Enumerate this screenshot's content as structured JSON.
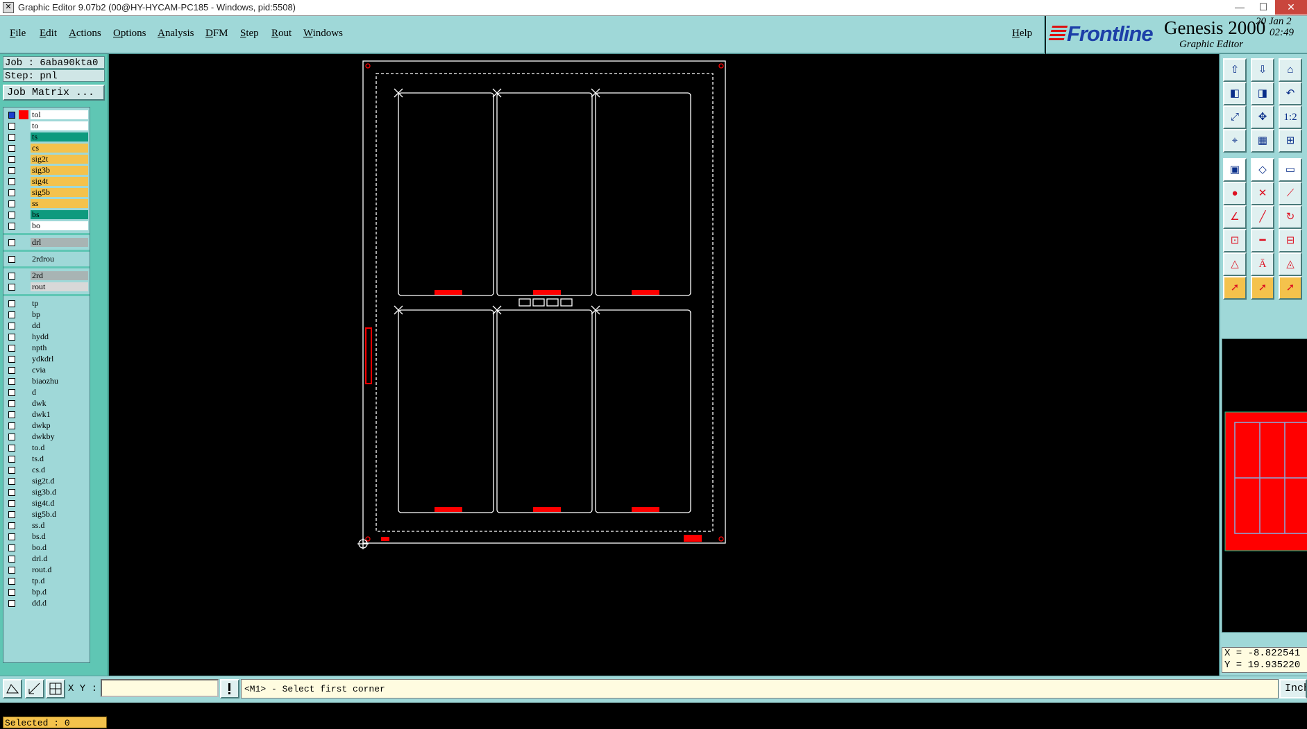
{
  "titlebar": {
    "title": "Graphic Editor 9.07b2 (00@HY-HYCAM-PC185 - Windows, pid:5508)"
  },
  "menu": [
    "File",
    "Edit",
    "Actions",
    "Options",
    "Analysis",
    "DFM",
    "Step",
    "Rout",
    "Windows"
  ],
  "help": "Help",
  "brand": {
    "logo": "Frontline",
    "product": "Genesis 2000",
    "subtitle": "Graphic Editor",
    "date": "20 Jan 2",
    "time": "02:49"
  },
  "job": {
    "job_line": "Job : 6aba90kta0",
    "step_line": "Step: pnl",
    "matrix_button": "Job Matrix ..."
  },
  "layer_groups": [
    [
      {
        "name": "tol",
        "color": "#ffffff"
      },
      {
        "name": "to",
        "color": "#ffffff"
      },
      {
        "name": "ts",
        "color": "#0e9a7e"
      },
      {
        "name": "cs",
        "color": "#f4c24c"
      },
      {
        "name": "sig2t",
        "color": "#f4c24c"
      },
      {
        "name": "sig3b",
        "color": "#f4c24c"
      },
      {
        "name": "sig4t",
        "color": "#f4c24c"
      },
      {
        "name": "sig5b",
        "color": "#f4c24c"
      },
      {
        "name": "ss",
        "color": "#f4c24c"
      },
      {
        "name": "bs",
        "color": "#0e9a7e"
      },
      {
        "name": "bo",
        "color": "#ffffff"
      }
    ],
    [
      {
        "name": "drl",
        "color": "#a8b4b4"
      }
    ],
    [
      {
        "name": "2rdrou",
        "color": "#9fd8d8"
      }
    ],
    [
      {
        "name": "2rd",
        "color": "#a8b4b4"
      },
      {
        "name": "rout",
        "color": "#d8d8d8"
      }
    ],
    [
      {
        "name": "tp",
        "color": "#9fd8d8"
      },
      {
        "name": "bp",
        "color": "#9fd8d8"
      },
      {
        "name": "dd",
        "color": "#9fd8d8"
      },
      {
        "name": "hydd",
        "color": "#9fd8d8"
      },
      {
        "name": "npth",
        "color": "#9fd8d8"
      },
      {
        "name": "ydkdrl",
        "color": "#9fd8d8"
      },
      {
        "name": "cvia",
        "color": "#9fd8d8"
      },
      {
        "name": "biaozhu",
        "color": "#9fd8d8"
      },
      {
        "name": "d",
        "color": "#9fd8d8"
      },
      {
        "name": "dwk",
        "color": "#9fd8d8"
      },
      {
        "name": "dwk1",
        "color": "#9fd8d8"
      },
      {
        "name": "dwkp",
        "color": "#9fd8d8"
      },
      {
        "name": "dwkby",
        "color": "#9fd8d8"
      },
      {
        "name": "to.d",
        "color": "#9fd8d8"
      },
      {
        "name": "ts.d",
        "color": "#9fd8d8"
      },
      {
        "name": "cs.d",
        "color": "#9fd8d8"
      },
      {
        "name": "sig2t.d",
        "color": "#9fd8d8"
      },
      {
        "name": "sig3b.d",
        "color": "#9fd8d8"
      },
      {
        "name": "sig4t.d",
        "color": "#9fd8d8"
      },
      {
        "name": "sig5b.d",
        "color": "#9fd8d8"
      },
      {
        "name": "ss.d",
        "color": "#9fd8d8"
      },
      {
        "name": "bs.d",
        "color": "#9fd8d8"
      },
      {
        "name": "bo.d",
        "color": "#9fd8d8"
      },
      {
        "name": "drl.d",
        "color": "#9fd8d8"
      },
      {
        "name": "rout.d",
        "color": "#9fd8d8"
      },
      {
        "name": "tp.d",
        "color": "#9fd8d8"
      },
      {
        "name": "bp.d",
        "color": "#9fd8d8"
      },
      {
        "name": "dd.d",
        "color": "#9fd8d8"
      }
    ]
  ],
  "selected_text": "Selected : 0",
  "coords": {
    "x": "X = -8.822541",
    "y": "Y = 19.935220"
  },
  "bottom": {
    "xy_label": "X Y :",
    "xy_value": "",
    "message": "<M1> - Select first corner",
    "units": "Inch"
  },
  "colors": {
    "panel": "#9fd8d8",
    "left_panel": "#5fc6b4",
    "highlight": "#f4c24c",
    "feature_red": "#ff0000",
    "outline": "#ffffff"
  },
  "toolbox_icons": [
    "move-to-top-icon",
    "move-to-bottom-icon",
    "home-view-icon",
    "pan-left-icon",
    "pan-right-icon",
    "undo-view-icon",
    "zoom-fit-icon",
    "zoom-center-icon",
    "zoom-ratio-icon",
    "snap-icon",
    "grid-icon",
    "layers-display-icon",
    "fill-mode-icon",
    "outline-mode-icon",
    "ruler-icon",
    "pad-icon",
    "cross-icon",
    "connect-icon",
    "line-icon",
    "slash-icon",
    "arc-icon",
    "select-area-icon",
    "horizontal-line-icon",
    "measure-icon",
    "triangle-icon",
    "polygon-icon",
    "surface-icon",
    "pointer-icon",
    "pointer-select-icon",
    "pointer-move-icon"
  ]
}
